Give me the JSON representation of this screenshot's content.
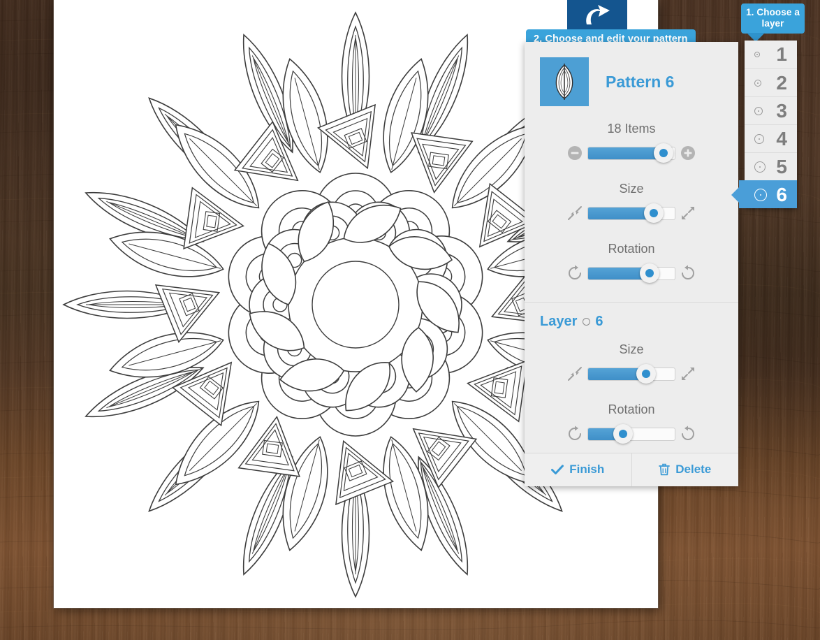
{
  "app": {
    "background": "wood-desk",
    "canvas_label": "mandala-coloring-artwork"
  },
  "colors": {
    "accent": "#3a9ad6",
    "callout_blue": "#3aa3db",
    "callout_tip": "#2f93cb",
    "panel_bg": "#ededed",
    "thumb_blue": "#2f8fce",
    "selected_layer": "#4a9ed8",
    "undo_chip": "#14558f",
    "wood": "#4e3524"
  },
  "callouts": {
    "step1": "1. Choose a layer",
    "step2": "2. Choose and edit your pattern"
  },
  "toolbar": {
    "undo_icon": "undo-arrow-icon"
  },
  "panel": {
    "pattern": {
      "thumb_icon": "leaf-petal-icon",
      "title": "Pattern 6",
      "items": {
        "label": "18 Items",
        "value": 18,
        "percent": 87,
        "decrease_icon": "minus-circle-icon",
        "increase_icon": "plus-circle-icon"
      },
      "size": {
        "label": "Size",
        "percent": 76,
        "decrease_icon": "shrink-arrows-icon",
        "increase_icon": "expand-arrows-icon"
      },
      "rotation": {
        "label": "Rotation",
        "percent": 71,
        "decrease_icon": "rotate-clockwise-icon",
        "increase_icon": "rotate-counterclockwise-icon"
      }
    },
    "layer": {
      "title": "Layer",
      "number": "6",
      "marker_icon": "layer-dot-icon",
      "size": {
        "label": "Size",
        "percent": 67,
        "decrease_icon": "shrink-arrows-icon",
        "increase_icon": "expand-arrows-icon"
      },
      "rotation": {
        "label": "Rotation",
        "percent": 40,
        "decrease_icon": "rotate-clockwise-icon",
        "increase_icon": "rotate-counterclockwise-icon"
      }
    },
    "footer": {
      "finish_label": "Finish",
      "finish_icon": "check-icon",
      "delete_label": "Delete",
      "delete_icon": "trash-icon"
    }
  },
  "layer_selector": {
    "selected": "6",
    "items": [
      {
        "label": "1",
        "dot_size": 8,
        "selected": false
      },
      {
        "label": "2",
        "dot_size": 10,
        "selected": false
      },
      {
        "label": "3",
        "dot_size": 12,
        "selected": false
      },
      {
        "label": "4",
        "dot_size": 14,
        "selected": false
      },
      {
        "label": "5",
        "dot_size": 16,
        "selected": false
      },
      {
        "label": "6",
        "dot_size": 18,
        "selected": true
      }
    ]
  }
}
